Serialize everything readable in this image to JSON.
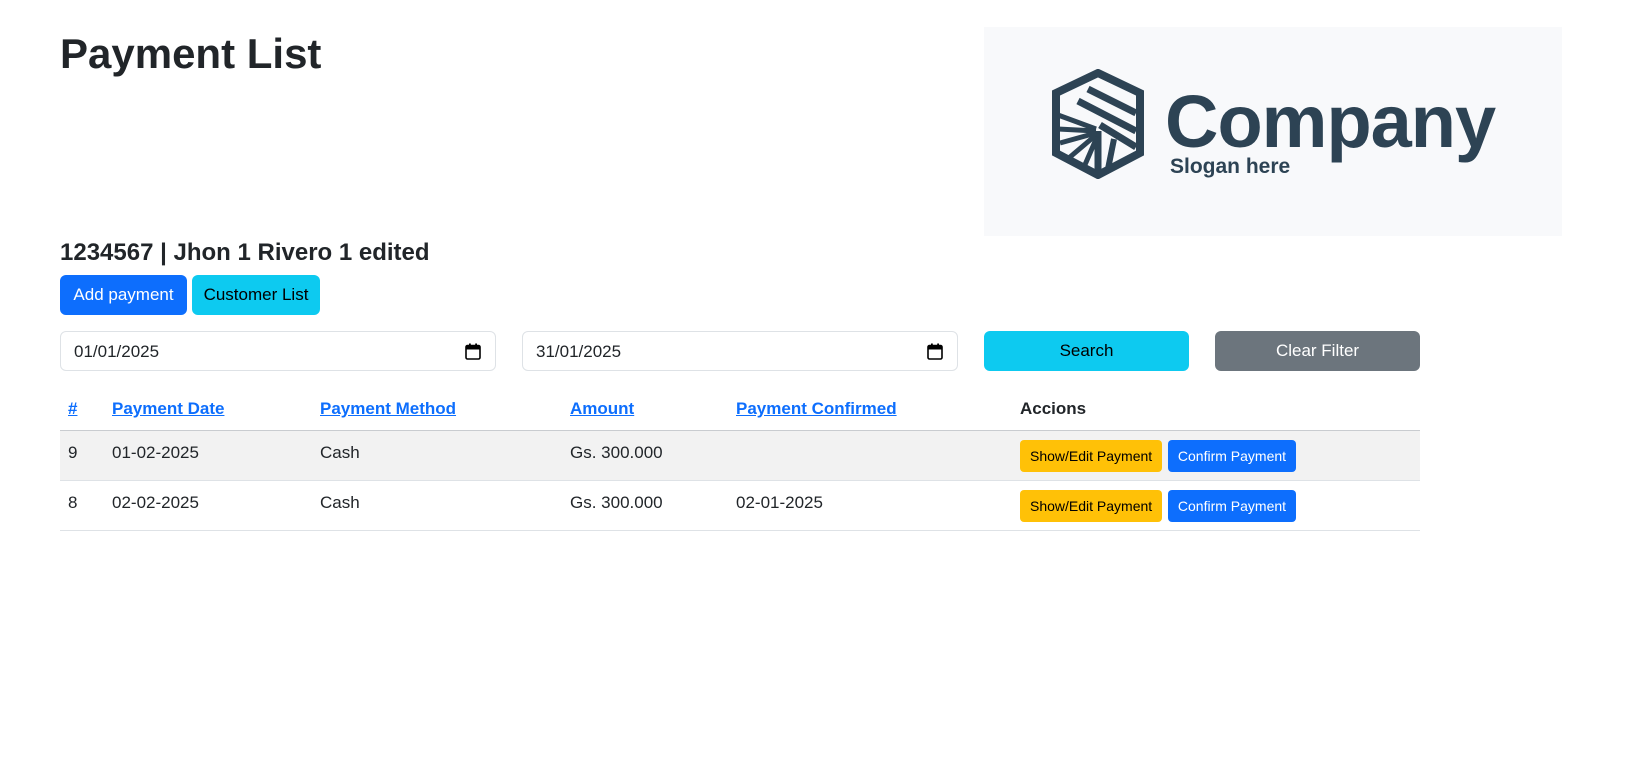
{
  "page": {
    "title": "Payment List"
  },
  "logo": {
    "name": "Company",
    "slogan": "Slogan here",
    "color": "#2d4354",
    "icon": "striped-cube-logo-icon"
  },
  "customer": {
    "heading": "1234567 | Jhon 1 Rivero 1 edited"
  },
  "buttons": {
    "add_payment": "Add payment",
    "customer_list": "Customer List",
    "search": "Search",
    "clear_filter": "Clear Filter"
  },
  "filters": {
    "date_from": "01/01/2025",
    "date_to": "31/01/2025",
    "calendar_icon": "calendar-icon"
  },
  "table": {
    "headers": {
      "id": "#",
      "payment_date": "Payment Date",
      "payment_method": "Payment Method",
      "amount": "Amount",
      "payment_confirmed": "Payment Confirmed",
      "actions": "Accions"
    },
    "rows": [
      {
        "id": "9",
        "payment_date": "01-02-2025",
        "payment_method": "Cash",
        "amount": "Gs. 300.000",
        "payment_confirmed": "",
        "edit_label": "Show/Edit Payment",
        "confirm_label": "Confirm Payment"
      },
      {
        "id": "8",
        "payment_date": "02-02-2025",
        "payment_method": "Cash",
        "amount": "Gs. 300.000",
        "payment_confirmed": "02-01-2025",
        "edit_label": "Show/Edit Payment",
        "confirm_label": "Confirm Payment"
      }
    ]
  },
  "colors": {
    "primary": "#0d6efd",
    "info": "#0dcaf0",
    "secondary": "#6c757d",
    "warning": "#ffc107"
  }
}
